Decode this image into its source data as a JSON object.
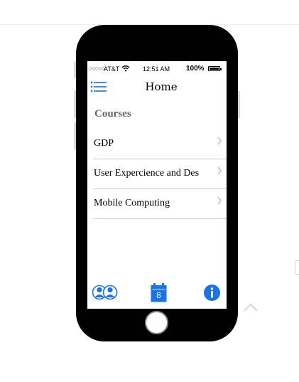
{
  "status_bar": {
    "signal": "○○○○○",
    "carrier": "AT&T",
    "time": "12:51 AM",
    "battery": "100%"
  },
  "nav": {
    "title": "Home"
  },
  "section": {
    "title": "Courses"
  },
  "courses": [
    {
      "label": "GDP"
    },
    {
      "label": "User Expercience and Des"
    },
    {
      "label": "Mobile Computing"
    }
  ],
  "tab_bar": {
    "calendar_day": "8"
  },
  "colors": {
    "accent": "#1a73e8",
    "frame": "#000000",
    "separator": "#cccccc",
    "section_text": "#666666"
  },
  "icons": {
    "menu": "hamburger-list-icon",
    "row": "chevron-right-icon",
    "users": "users-icon",
    "calendar": "calendar-icon",
    "info": "info-icon",
    "wifi": "wifi-icon",
    "battery": "battery-icon",
    "scroll": "chevron-up-icon"
  }
}
